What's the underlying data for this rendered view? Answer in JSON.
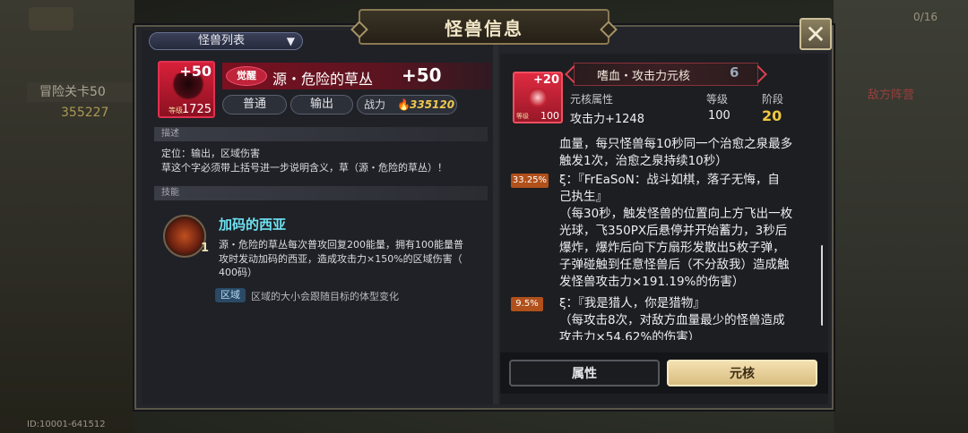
{
  "background": {
    "stage_label": "冒险关卡50",
    "stage_power": "355227",
    "user_id": "ID:10001-641512",
    "top_right_count": "0/16",
    "right_label": "敌方阵营"
  },
  "header": {
    "title": "怪兽信息",
    "close_label": "✕",
    "dropdown_label": "怪兽列表",
    "dropdown_arrow": "▼"
  },
  "monster": {
    "plus": "+50",
    "level_label": "等级",
    "level": "1725",
    "rarity": "觉醒",
    "name": "源・危险的草丛",
    "plus_level": "+50",
    "tags": [
      "普通",
      "输出"
    ],
    "power_label": "战力",
    "power_value": "335120"
  },
  "description": {
    "heading": "描述",
    "line1": "定位：输出，区域伤害",
    "line2": "草这个字必须带上括号进一步说明含义，草（源・危险的草丛）！"
  },
  "skill": {
    "heading": "技能",
    "count": "1",
    "name": "加码的西亚",
    "desc_lines": [
      "源・危险的草丛每次普攻回复200能量，拥有100能量普",
      "攻时发动加码的西亚，造成攻击力×150%的区域伤害（",
      "400码）"
    ],
    "area_tag": "区域",
    "area_desc": "区域的大小会跟随目标的体型变化"
  },
  "core": {
    "plus": "+20",
    "level_label": "等级",
    "level": "100",
    "name": "嗜血・攻击力元核",
    "stage_badge": "6",
    "attr_label": "元核属性",
    "attr_value": "攻击力+1248",
    "lvl_label": "等级",
    "lvl_value": "100",
    "stage_label": "阶段",
    "stage_value": "20"
  },
  "effects": {
    "line_a1": "血量，每只怪兽每10秒同一个治愈之泉最多",
    "line_a2": "触发1次，治愈之泉持续10秒）",
    "effect1_pct": "33.25%",
    "effect1_title1": "ξ：『FrEaSoN：战斗如棋，落子无悔，自",
    "effect1_title2": "己执生』",
    "effect1_lines": [
      "（每30秒，触发怪兽的位置向上方飞出一枚",
      "光球，飞350PX后悬停并开始蓄力，3秒后",
      "爆炸，爆炸后向下方扇形发散出5枚子弹，",
      "子弹碰触到任意怪兽后（不分敌我）造成触",
      "发怪兽攻击力×191.19%的伤害）"
    ],
    "effect2_pct": "9.5%",
    "effect2_title": "ξ：『我是猎人，你是猎物』",
    "effect2_lines": [
      "（每攻击8次，对敌方血量最少的怪兽造成",
      "攻击力×54.62%的伤害）"
    ]
  },
  "tabs": {
    "attr": "属性",
    "core": "元核"
  },
  "colors": {
    "accent_gold": "#f0c850",
    "skill_cyan": "#6ee0f0",
    "pct_orange": "#b0501a",
    "rarity_red": "#c0243a"
  }
}
